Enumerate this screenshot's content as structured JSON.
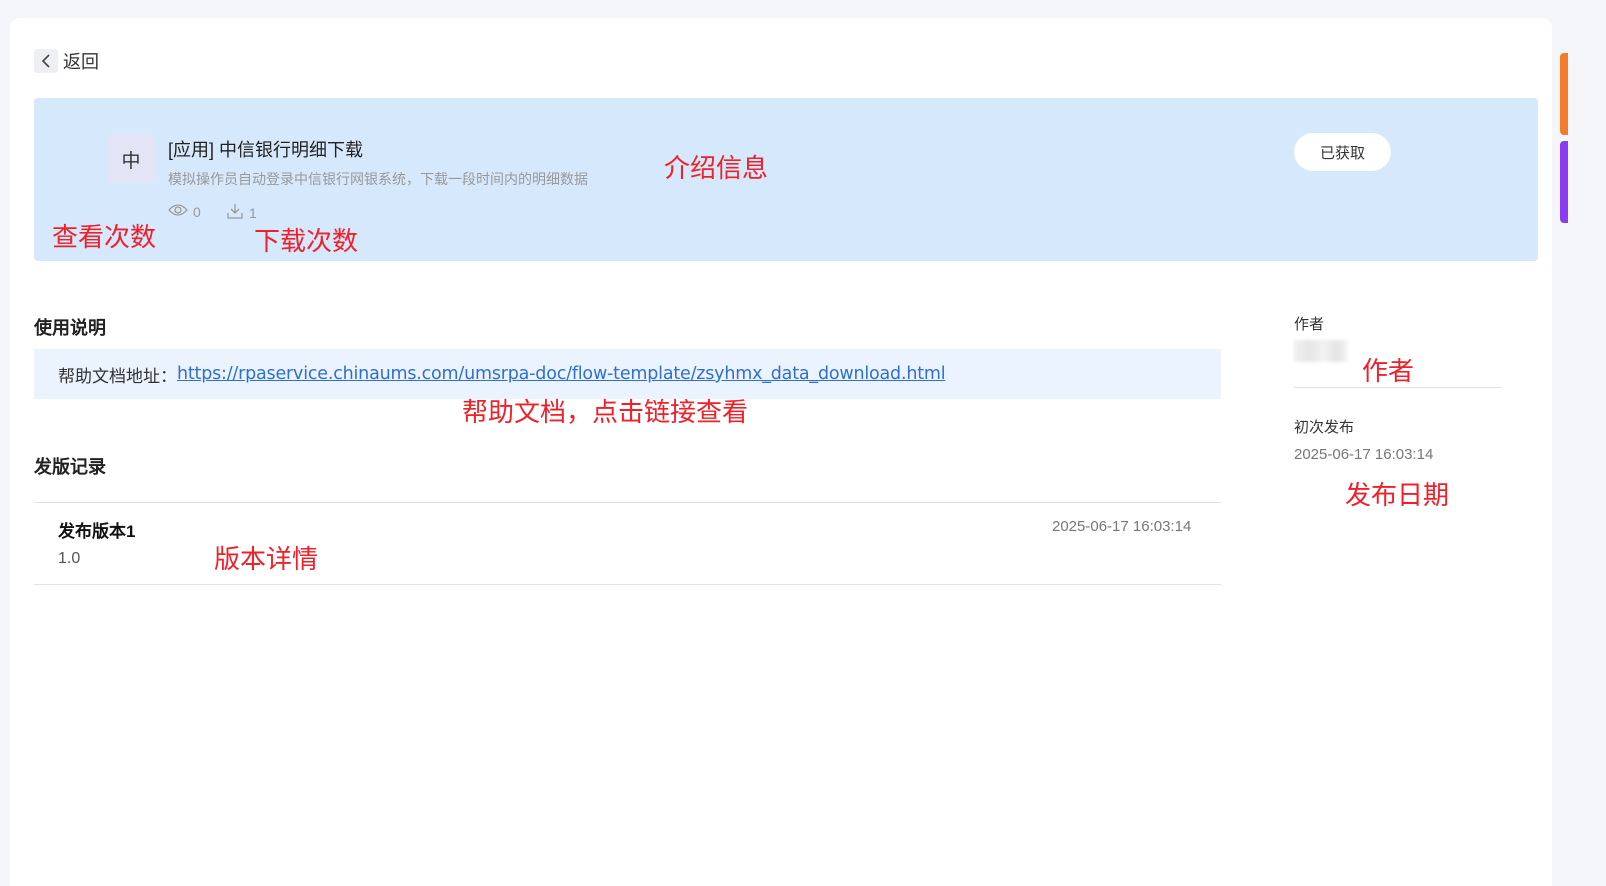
{
  "back_label": "返回",
  "app": {
    "avatar_char": "中",
    "title": "[应用] 中信银行明细下载",
    "description": "模拟操作员自动登录中信银行网银系统，下载一段时间内的明细数据",
    "views": "0",
    "downloads": "1",
    "status_button": "已获取"
  },
  "usage": {
    "title": "使用说明",
    "help_label": "帮助文档地址：",
    "help_url": "https://rpaservice.chinaums.com/umsrpa-doc/flow-template/zsyhmx_data_download.html"
  },
  "releases": {
    "title": "发版记录",
    "items": [
      {
        "name": "发布版本1",
        "version": "1.0",
        "date": "2025-06-17 16:03:14"
      }
    ]
  },
  "sidebar": {
    "author_label": "作者",
    "first_publish_label": "初次发布",
    "first_publish_date": "2025-06-17 16:03:14"
  },
  "annotations": {
    "intro": "介绍信息",
    "views": "查看次数",
    "downloads": "下载次数",
    "help": "帮助文档，点击链接查看",
    "version": "版本详情",
    "author": "作者",
    "date": "发布日期"
  },
  "colors": {
    "banner_bg": "#d6e8fb",
    "link": "#2f6fd3",
    "annotation": "#f0202a"
  }
}
